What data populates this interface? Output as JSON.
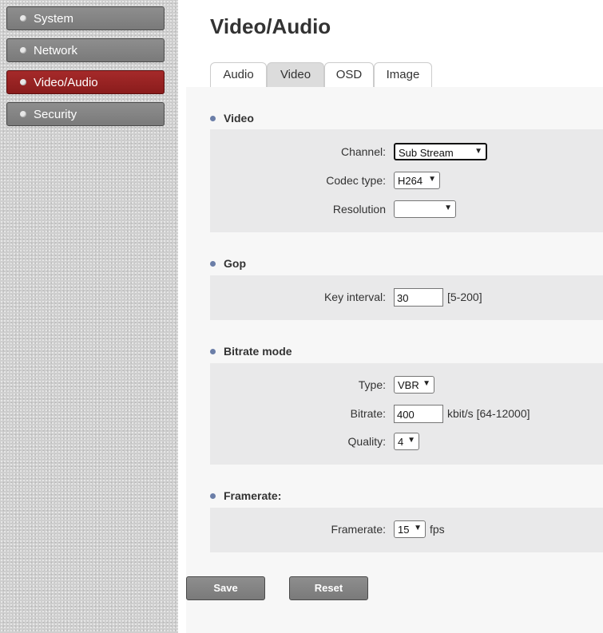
{
  "sidebar": {
    "items": [
      {
        "label": "System"
      },
      {
        "label": "Network"
      },
      {
        "label": "Video/Audio"
      },
      {
        "label": "Security"
      }
    ]
  },
  "header": {
    "title": "Video/Audio"
  },
  "tabs": [
    {
      "label": "Audio"
    },
    {
      "label": "Video"
    },
    {
      "label": "OSD"
    },
    {
      "label": "Image"
    }
  ],
  "sections": {
    "video": {
      "title": "Video",
      "channel": {
        "label": "Channel:",
        "value": "Sub Stream"
      },
      "codec": {
        "label": "Codec type:",
        "value": "H264"
      },
      "resolution": {
        "label": "Resolution",
        "value": ""
      }
    },
    "gop": {
      "title": "Gop",
      "key_interval": {
        "label": "Key interval:",
        "value": "30",
        "range": "[5-200]"
      }
    },
    "bitrate_mode": {
      "title": "Bitrate mode",
      "type": {
        "label": "Type:",
        "value": "VBR"
      },
      "bitrate": {
        "label": "Bitrate:",
        "value": "400",
        "unit": "kbit/s [64-12000]"
      },
      "quality": {
        "label": "Quality:",
        "value": "4"
      }
    },
    "framerate": {
      "title": "Framerate:",
      "framerate": {
        "label": "Framerate:",
        "value": "15",
        "unit": "fps"
      }
    }
  },
  "buttons": {
    "save": "Save",
    "reset": "Reset"
  },
  "icons": {
    "nav_bullet": "bullet-dot-icon",
    "section_bullet": "section-bullet-icon",
    "select_arrow": "chevron-down-icon"
  },
  "colors": {
    "active_nav": "#8a1c1c",
    "nav": "#808080",
    "section_bullet": "#6b7ea8"
  }
}
